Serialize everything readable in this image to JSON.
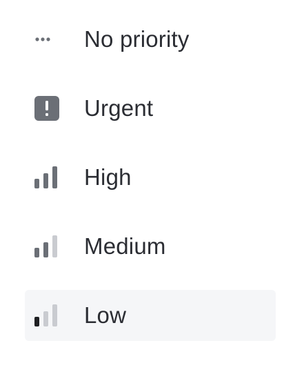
{
  "menu": {
    "items": [
      {
        "label": "No priority",
        "icon": "dots-icon"
      },
      {
        "label": "Urgent",
        "icon": "urgent-icon"
      },
      {
        "label": "High",
        "icon": "bars-high-icon"
      },
      {
        "label": "Medium",
        "icon": "bars-medium-icon"
      },
      {
        "label": "Low",
        "icon": "bars-low-icon"
      }
    ],
    "highlighted_item": "Low"
  },
  "colors": {
    "icon_active": "#6b6f76",
    "icon_inactive": "#c9cbd0",
    "text": "#2b2d33",
    "hover_bg": "#f5f6f8"
  }
}
